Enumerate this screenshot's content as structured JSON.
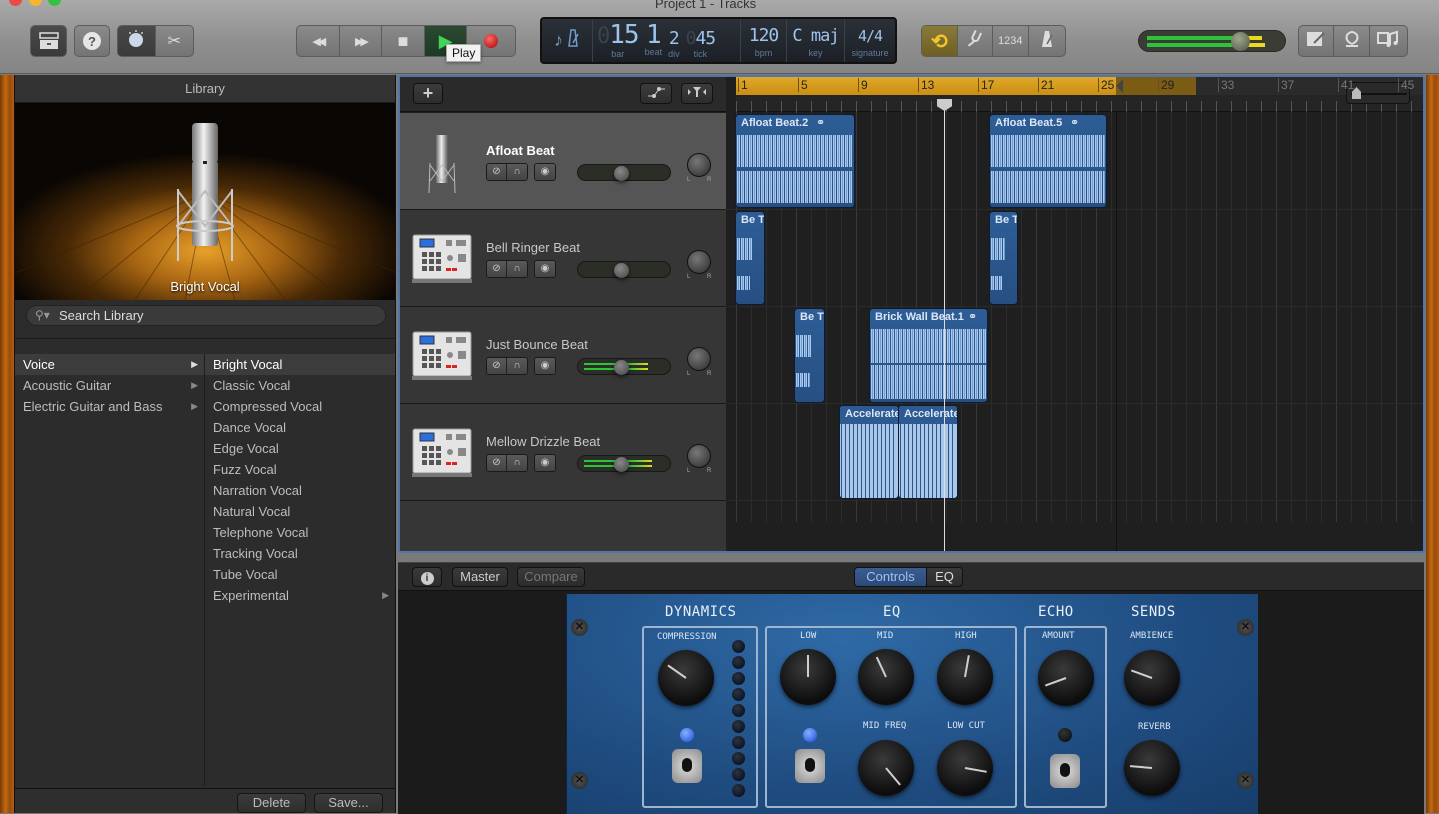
{
  "window": {
    "title": "Project 1 - Tracks"
  },
  "toolbar": {
    "left_buttons": [
      {
        "name": "library",
        "icon": "library-drawer-icon"
      },
      {
        "name": "quick-help",
        "icon": "question-icon"
      },
      {
        "name": "smart-controls",
        "icon": "knob-icon"
      },
      {
        "name": "editors",
        "icon": "scissors-icon"
      }
    ],
    "transport": [
      {
        "name": "rewind",
        "glyph": "◀◀"
      },
      {
        "name": "fast-forward",
        "glyph": "▶▶"
      },
      {
        "name": "stop",
        "glyph": "■"
      },
      {
        "name": "play",
        "glyph": "▶"
      },
      {
        "name": "record",
        "glyph": "●"
      }
    ],
    "tooltip": "Play",
    "lcd": {
      "mode_icons": [
        "♪",
        "metronome"
      ],
      "bar_dim": "0",
      "bar": "15",
      "beat": "1",
      "div": "2",
      "tick_dim": "0",
      "tick": "45",
      "bpm": "120",
      "key": "C maj",
      "signature": "4/4",
      "labels": {
        "bar": "bar",
        "beat": "beat",
        "div": "div",
        "tick": "tick",
        "bpm": "bpm",
        "key": "key",
        "signature": "signature"
      }
    },
    "mode_buttons": [
      {
        "name": "cycle",
        "glyph": "⟲",
        "active": true
      },
      {
        "name": "tuner",
        "glyph": "⑂"
      },
      {
        "name": "count-in",
        "label": "1234"
      },
      {
        "name": "metronome",
        "glyph": "△"
      }
    ],
    "master_volume": 0.68,
    "right_buttons": [
      {
        "name": "notepad",
        "icon": "notepad-icon"
      },
      {
        "name": "loop-browser",
        "icon": "loop-icon"
      },
      {
        "name": "media-browser",
        "icon": "media-icon"
      }
    ]
  },
  "library": {
    "header": "Library",
    "preview_label": "Bright Vocal",
    "search_placeholder": "Search Library",
    "categories": [
      {
        "label": "Voice",
        "selected": true,
        "arrow": "▶"
      },
      {
        "label": "Acoustic Guitar",
        "arrow": "▶"
      },
      {
        "label": "Electric Guitar and Bass",
        "arrow": "▶"
      }
    ],
    "patches": [
      {
        "label": "Bright Vocal",
        "selected": true
      },
      {
        "label": "Classic Vocal"
      },
      {
        "label": "Compressed Vocal"
      },
      {
        "label": "Dance Vocal"
      },
      {
        "label": "Edge Vocal"
      },
      {
        "label": "Fuzz Vocal"
      },
      {
        "label": "Narration Vocal"
      },
      {
        "label": "Natural Vocal"
      },
      {
        "label": "Telephone Vocal"
      },
      {
        "label": "Tracking Vocal"
      },
      {
        "label": "Tube Vocal"
      },
      {
        "label": "Experimental",
        "arrow": "▶"
      }
    ],
    "delete_label": "Delete",
    "save_label": "Save..."
  },
  "tracks_header": {
    "add_glyph": "+",
    "automation_glyph": "⟋",
    "filter_glyph": "▼"
  },
  "tracks": [
    {
      "name": "Afloat Beat",
      "icon": "microphone",
      "selected": true,
      "volume": 0.5,
      "meter": 0
    },
    {
      "name": "Bell Ringer Beat",
      "icon": "drum-machine",
      "volume": 0.5,
      "meter": 0
    },
    {
      "name": "Just Bounce Beat",
      "icon": "drum-machine",
      "volume": 0.5,
      "meter": 0.8
    },
    {
      "name": "Mellow Drizzle Beat",
      "icon": "drum-machine",
      "volume": 0.5,
      "meter": 0.85
    }
  ],
  "track_button_glyphs": {
    "mute": "⊘",
    "solo": "∩",
    "record": "◉",
    "pan_l": "L",
    "pan_r": "R"
  },
  "ruler": {
    "bars": [
      "1",
      "5",
      "9",
      "13",
      "17",
      "21",
      "25",
      "29",
      "33",
      "37",
      "41",
      "45"
    ],
    "cycle_range": [
      1,
      25
    ]
  },
  "regions": [
    {
      "track": 0,
      "title": "Afloat Beat.2",
      "loop_icon": true
    },
    {
      "track": 0,
      "title": "Afloat Beat.5",
      "loop_icon": true
    },
    {
      "track": 1,
      "title": "Be T"
    },
    {
      "track": 1,
      "title": "Be T"
    },
    {
      "track": 2,
      "title": "Be T"
    },
    {
      "track": 2,
      "title": "Brick Wall Beat.1",
      "loop_icon": true
    },
    {
      "track": 3,
      "title": "Accelerate"
    },
    {
      "track": 3,
      "title": "Accelerate"
    }
  ],
  "smart_controls": {
    "info_glyph": "i",
    "master_label": "Master",
    "compare_label": "Compare",
    "tabs": [
      {
        "label": "Controls",
        "active": true
      },
      {
        "label": "EQ"
      }
    ],
    "sections": {
      "dynamics": "DYNAMICS",
      "eq": "EQ",
      "echo": "ECHO",
      "sends": "SENDS"
    },
    "knobs": {
      "compression": "COMPRESSION",
      "low": "LOW",
      "mid": "MID",
      "high": "HIGH",
      "mid_freq": "MID FREQ",
      "low_cut": "LOW CUT",
      "amount": "AMOUNT",
      "ambience": "AMBIENCE",
      "reverb": "REVERB"
    },
    "leds": {
      "dynamics": true,
      "eq": true,
      "echo": false
    }
  }
}
